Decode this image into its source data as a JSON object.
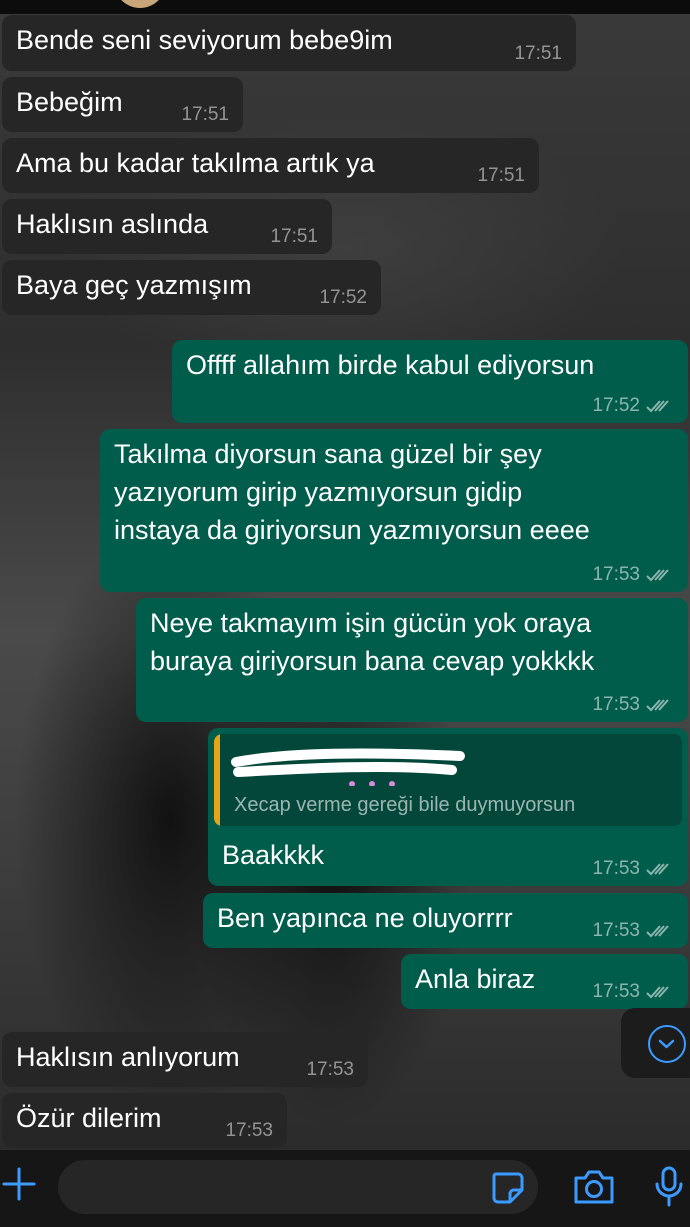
{
  "messages": [
    {
      "dir": "in",
      "text": "Bende seni seviyorum bebe9im",
      "time": "17:51"
    },
    {
      "dir": "in",
      "text": "Bebeğim",
      "time": "17:51"
    },
    {
      "dir": "in",
      "text": "Ama bu kadar takılma artık ya",
      "time": "17:51"
    },
    {
      "dir": "in",
      "text": "Haklısın aslında",
      "time": "17:51"
    },
    {
      "dir": "in",
      "text": "Baya geç yazmışım",
      "time": "17:52"
    },
    {
      "dir": "out",
      "text": "Offff allahım birde kabul ediyorsun",
      "time": "17:52"
    },
    {
      "dir": "out",
      "text": "Takılma diyorsun sana güzel bir şey\nyazıyorum girip yazmıyorsun gidip\ninstaya da giriyorsun yazmıyorsun eeee",
      "time": "17:53"
    },
    {
      "dir": "out",
      "text": "Neye takmayım işin gücün yok oraya\nburaya giriyorsun bana cevap yokkkk",
      "time": "17:53"
    },
    {
      "dir": "out",
      "text": "Baakkkk",
      "time": "17:53",
      "quote": "Xecap verme gereği bile duymuyorsun"
    },
    {
      "dir": "out",
      "text": "Ben yapınca ne oluyorrrr",
      "time": "17:53"
    },
    {
      "dir": "out",
      "text": "Anla biraz",
      "time": "17:53"
    },
    {
      "dir": "in",
      "text": "Haklısın anlıyorum",
      "time": "17:53"
    },
    {
      "dir": "in",
      "text": "Özür dilerim",
      "time": "17:53"
    }
  ],
  "composer": {
    "value": "",
    "placeholder": ""
  },
  "icons": {
    "attach": "plus-icon",
    "sticker": "sticker-icon",
    "camera": "camera-icon",
    "mic": "microphone-icon",
    "scroll": "chevron-down-icon",
    "read": "double-check-icon"
  },
  "colors": {
    "incoming": "#262626",
    "outgoing": "#005c4b",
    "accent": "#3b9bff",
    "quote_bar": "#e8a317"
  }
}
